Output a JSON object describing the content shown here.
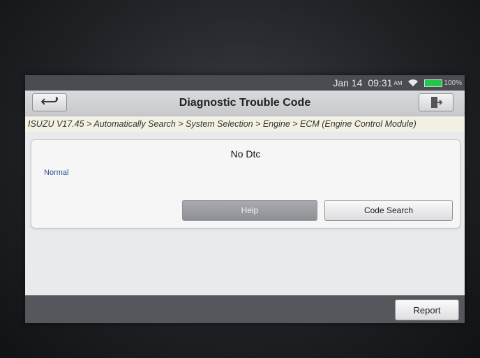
{
  "statusbar": {
    "date": "Jan 14",
    "time": "09:31",
    "ampm": "AM",
    "battery": "100%"
  },
  "header": {
    "title": "Diagnostic Trouble Code",
    "back_icon": "back-arrow-icon",
    "exit_icon": "exit-icon"
  },
  "breadcrumb": {
    "path": "ISUZU V17.45 > Automatically Search > System Selection > Engine > ECM (Engine Control Module)"
  },
  "main": {
    "dtc_text": "No Dtc",
    "status_text": "Normal",
    "help_label": "Help",
    "code_search_label": "Code Search"
  },
  "footer": {
    "report_label": "Report"
  },
  "colors": {
    "battery": "#22c84a",
    "status_text": "#2d4f9b"
  }
}
